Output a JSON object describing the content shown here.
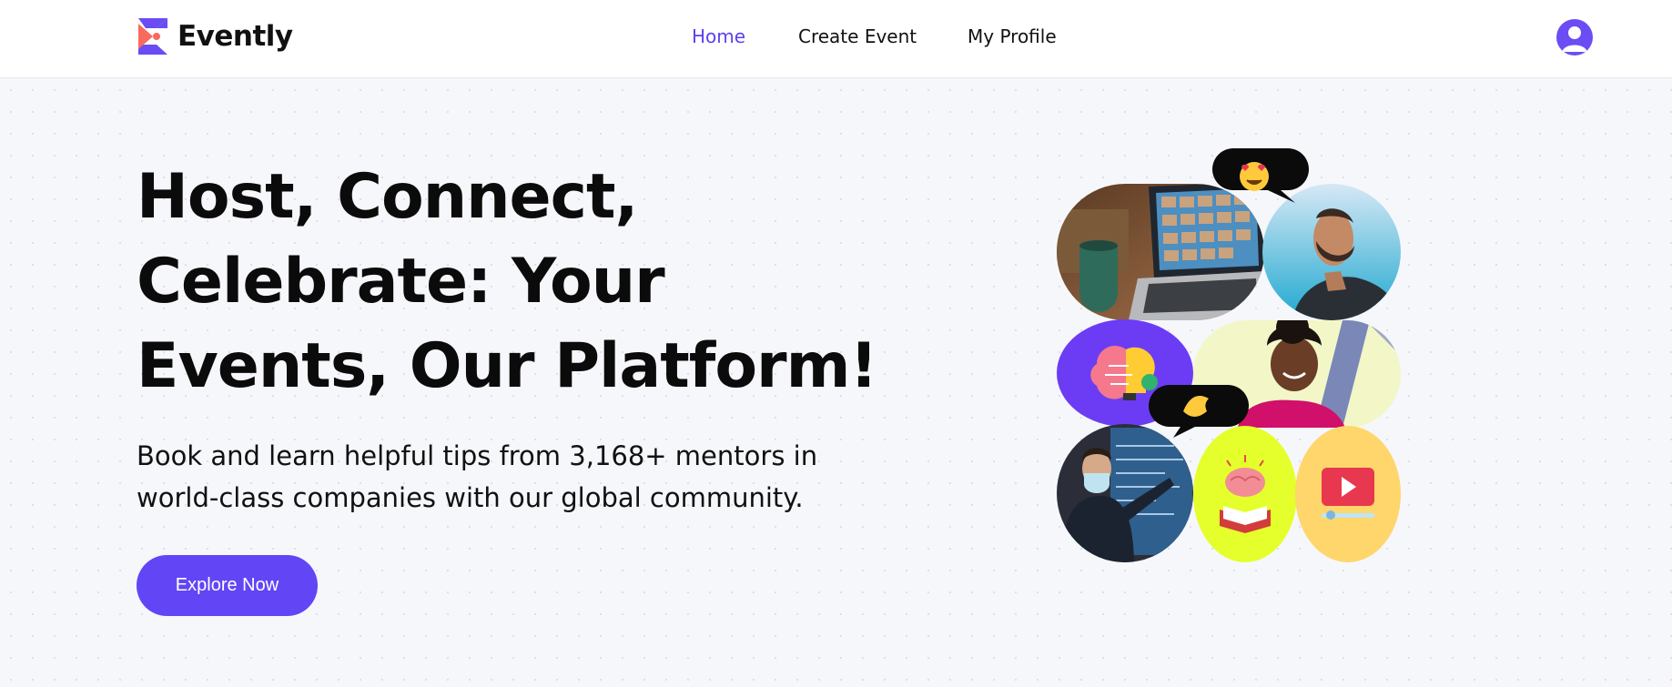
{
  "header": {
    "brand": "Evently",
    "nav": [
      {
        "label": "Home",
        "active": true
      },
      {
        "label": "Create Event",
        "active": false
      },
      {
        "label": "My Profile",
        "active": false
      }
    ]
  },
  "hero": {
    "headline_lines": [
      "Host, Connect,",
      "Celebrate: Your",
      "Events, Our Platform!"
    ],
    "subtext_lines": [
      "Book and learn helpful tips from 3,168+ mentors in",
      "world-class companies with our global community."
    ],
    "cta_label": "Explore Now"
  },
  "collage": {
    "items": [
      {
        "name": "video-call-laptop-photo"
      },
      {
        "name": "laughing-man-photo"
      },
      {
        "name": "brain-lightbulb-illustration"
      },
      {
        "name": "smiling-woman-photo"
      },
      {
        "name": "presenter-photo"
      },
      {
        "name": "brain-book-illustration"
      },
      {
        "name": "video-play-illustration"
      }
    ],
    "emoji_bubbles": [
      "heart-eyes-emoji",
      "pinching-hand-emoji"
    ]
  },
  "colors": {
    "accent": "#6245f5",
    "nav_active": "#5b41f0",
    "background": "#f6f7fb",
    "tile_purple": "#6c3cf5",
    "tile_lime": "#e4ff2b",
    "tile_yellow": "#ffd66b"
  }
}
